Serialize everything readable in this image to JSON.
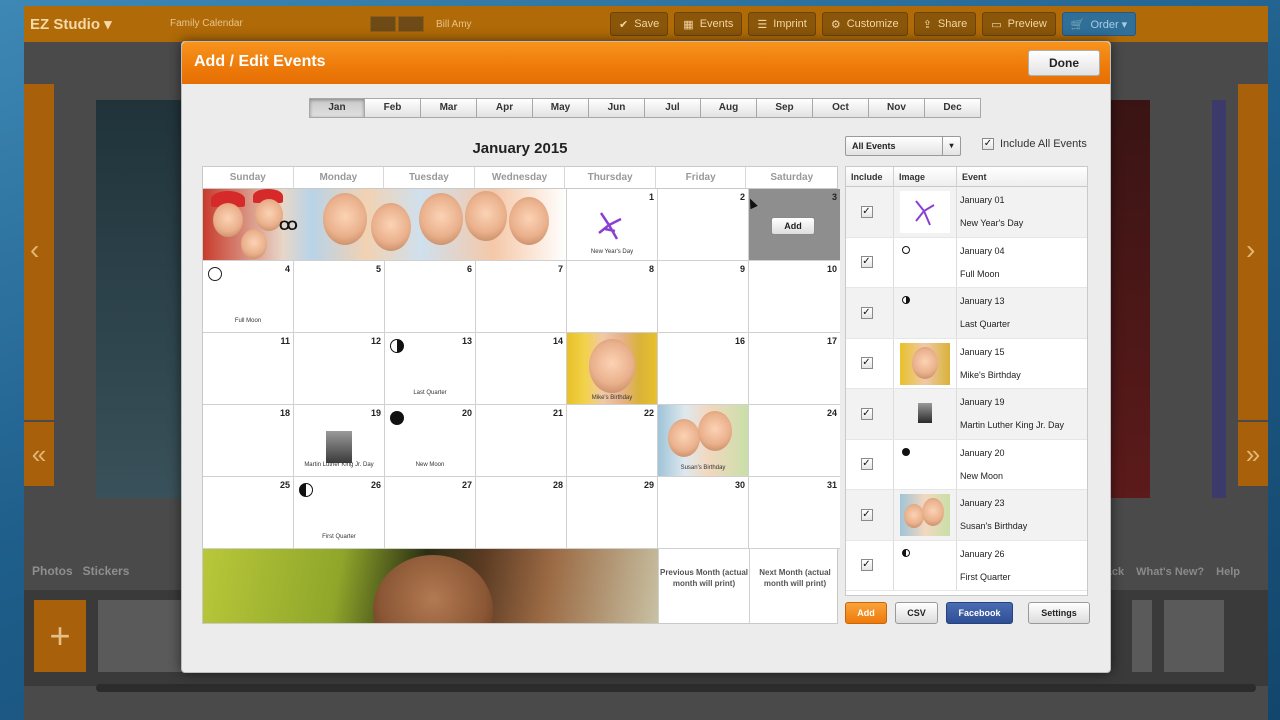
{
  "background_app": {
    "brand": "EZ Studio ▾",
    "project_line1": "Family Calendar",
    "view_label": "Bill Amy",
    "toolbar": [
      {
        "label": "Save",
        "icon": "checkmark-icon"
      },
      {
        "label": "Events",
        "icon": "calendar-icon"
      },
      {
        "label": "Imprint",
        "icon": "lines-icon"
      },
      {
        "label": "Customize",
        "icon": "gear-icon"
      },
      {
        "label": "Share",
        "icon": "share-icon"
      },
      {
        "label": "Preview",
        "icon": "monitor-icon"
      }
    ],
    "order_label": "Order ▾",
    "bottom_tabs": [
      "Photos",
      "Stickers"
    ],
    "bottom_links": [
      "Feedback",
      "What's New?",
      "Help"
    ]
  },
  "modal": {
    "title": "Add / Edit Events",
    "done_label": "Done",
    "months": [
      "Jan",
      "Feb",
      "Mar",
      "Apr",
      "May",
      "Jun",
      "Jul",
      "Aug",
      "Sep",
      "Oct",
      "Nov",
      "Dec"
    ],
    "active_month": "Jan",
    "calendar_title": "January 2015",
    "weekdays": [
      "Sunday",
      "Monday",
      "Tuesday",
      "Wednesday",
      "Thursday",
      "Friday",
      "Saturday"
    ],
    "add_cell_label": "Add",
    "cell_labels": {
      "d1": "New Year's Day",
      "d4": "Full Moon",
      "d13": "Last Quarter",
      "d15": "Mike's Birthday",
      "d19": "Martin Luther King Jr. Day",
      "d20": "New Moon",
      "d23": "Susan's Birthday",
      "d26": "First Quarter"
    },
    "prev_month_text": "Previous Month (actual month will print)",
    "next_month_text": "Next Month (actual month will print)",
    "filter": {
      "selected": "All Events",
      "caret": "▾"
    },
    "include_all_label": "Include All Events",
    "include_all_checked": true,
    "list_headers": {
      "include": "Include",
      "image": "Image",
      "event": "Event"
    },
    "events": [
      {
        "date": "January 01",
        "name": "New Year's Day",
        "included": "✓"
      },
      {
        "date": "January 04",
        "name": "Full Moon",
        "included": "✓"
      },
      {
        "date": "January 13",
        "name": "Last Quarter",
        "included": "✓"
      },
      {
        "date": "January 15",
        "name": "Mike's Birthday",
        "included": "✓"
      },
      {
        "date": "January 19",
        "name": "Martin Luther King Jr. Day",
        "included": "✓"
      },
      {
        "date": "January 20",
        "name": "New Moon",
        "included": "✓"
      },
      {
        "date": "January 23",
        "name": "Susan's Birthday",
        "included": "✓"
      },
      {
        "date": "January 26",
        "name": "First Quarter",
        "included": "✓"
      }
    ],
    "buttons": {
      "add": "Add",
      "csv": "CSV",
      "facebook": "Facebook",
      "settings": "Settings"
    }
  },
  "colors": {
    "header_orange": "#ee7a0a",
    "facebook_blue": "#3b5998",
    "selected_cell": "#8e8e8e"
  }
}
